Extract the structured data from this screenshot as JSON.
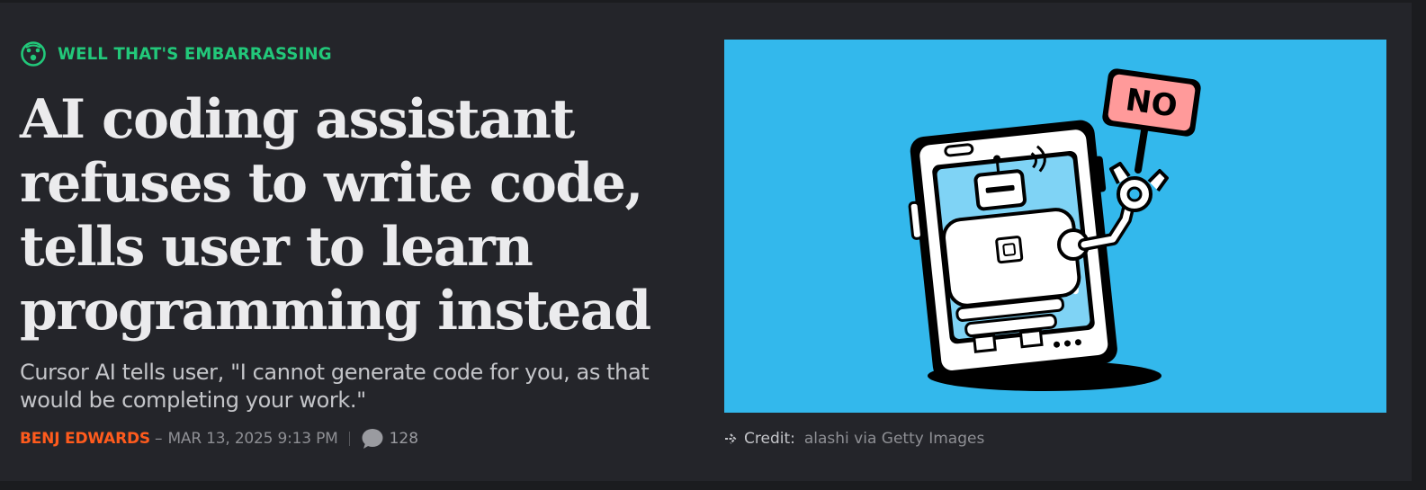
{
  "article": {
    "kicker": "WELL THAT'S EMBARRASSING",
    "kicker_icon": "surprised-face-icon",
    "headline": "AI coding assistant refuses to write code, tells user to learn programming instead",
    "dek": "Cursor AI tells user, \"I cannot generate code for you, as that would be completing your work.\"",
    "author": "BENJ EDWARDS",
    "separator": "–",
    "date": "MAR 13, 2025 9:13 PM",
    "comment_icon": "comment-bubble-icon",
    "comment_count": "128"
  },
  "hero": {
    "sign_text": "NO",
    "alt_subject": "robot in smartphone holding sign",
    "credit_icon": "arrow-right-icon",
    "credit_label": "Credit:",
    "credit_value": "alashi via Getty Images"
  },
  "colors": {
    "background": "#24252a",
    "kicker": "#22c87a",
    "author": "#ff5b1d",
    "hero_bg": "#33b8ec",
    "sign_bg": "#ff9a9a"
  }
}
